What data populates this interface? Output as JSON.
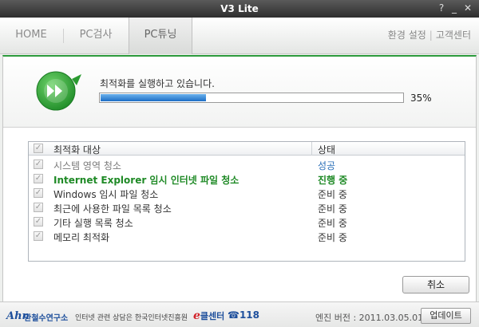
{
  "window": {
    "title": "V3 Lite",
    "help_label": "?",
    "minimize_label": "_",
    "close_label": "✕"
  },
  "tabs": [
    {
      "label": "HOME"
    },
    {
      "label": "PC검사"
    },
    {
      "label": "PC튜닝"
    }
  ],
  "toplinks": {
    "settings": "환경 설정",
    "separator": "|",
    "support": "고객센터"
  },
  "status": {
    "message": "최적화를 실행하고 있습니다.",
    "progress_percent": 35,
    "progress_label": "35%"
  },
  "list": {
    "header": {
      "name": "최적화 대상",
      "state": "상태"
    },
    "rows": [
      {
        "name": "시스템 영역 청소",
        "state": "성공",
        "status": "done"
      },
      {
        "name": "Internet Explorer 임시 인터넷 파일 청소",
        "state": "진행 중",
        "status": "active"
      },
      {
        "name": "Windows 임시 파일 청소",
        "state": "준비 중",
        "status": "pending"
      },
      {
        "name": "최근에 사용한 파일 목록 청소",
        "state": "준비 중",
        "status": "pending"
      },
      {
        "name": "기타 실행 목록 청소",
        "state": "준비 중",
        "status": "pending"
      },
      {
        "name": "메모리 최적화",
        "state": "준비 중",
        "status": "pending"
      }
    ]
  },
  "buttons": {
    "cancel": "취소",
    "update": "업데이트"
  },
  "footer": {
    "logo_mark": "Ahn",
    "lab_name": "안철수연구소",
    "consult_text": "인터넷 관련 상담은 한국인터넷진흥원",
    "ecenter_e": "e",
    "ecenter_label": "클센터",
    "phone": "☎118",
    "engine_version": "엔진 버전 : 2011.03.05.01"
  },
  "colors": {
    "accent_green": "#2c9a3c",
    "progress_blue": "#1c6dc6",
    "active_text": "#1f8a26",
    "done_text": "#2a6fb8"
  }
}
